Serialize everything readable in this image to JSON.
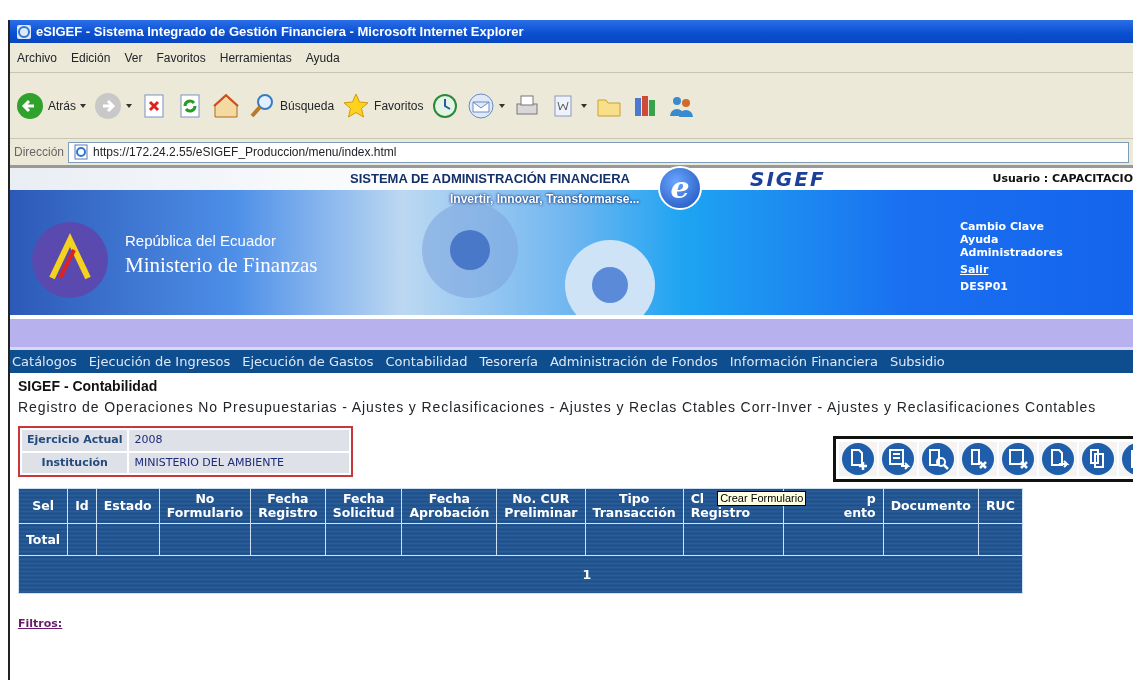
{
  "window": {
    "title": "eSIGEF - Sistema Integrado de Gestión Financiera - Microsoft Internet Explorer"
  },
  "menu": [
    "Archivo",
    "Edición",
    "Ver",
    "Favoritos",
    "Herramientas",
    "Ayuda"
  ],
  "browser_toolbar": [
    {
      "kind": "back",
      "label": "Atrás",
      "dropdown": true
    },
    {
      "kind": "forward",
      "dropdown": true
    },
    {
      "kind": "stop",
      "dropdown": false
    },
    {
      "kind": "refresh",
      "dropdown": false
    },
    {
      "kind": "home",
      "dropdown": false
    },
    {
      "kind": "search",
      "label": "Búsqueda",
      "dropdown": false
    },
    {
      "kind": "favorites",
      "label": "Favoritos",
      "dropdown": false
    },
    {
      "kind": "history",
      "dropdown": false
    },
    {
      "kind": "mail",
      "dropdown": true
    },
    {
      "kind": "print",
      "dropdown": false
    },
    {
      "kind": "word",
      "dropdown": true
    },
    {
      "kind": "folder",
      "dropdown": false
    },
    {
      "kind": "tool",
      "dropdown": false
    },
    {
      "kind": "people",
      "dropdown": false
    }
  ],
  "address_bar": {
    "label": "Dirección",
    "value": "https://172.24.2.55/eSIGEF_Produccion/menu/index.html"
  },
  "header": {
    "system_title": "SISTEMA DE ADMINISTRACIÓN FINANCIERA",
    "slogan": "Invertir, Innovar, Transformarse...",
    "e_logo": "e",
    "sigef_logo": "SIGEF",
    "country": "República del Ecuador",
    "ministry": "Ministerio de Finanzas",
    "user": "Usuario : CAPACITACIO",
    "links": [
      {
        "text": "Cambio Clave",
        "underlined": false
      },
      {
        "text": "Ayuda",
        "underlined": false
      },
      {
        "text": "Administradores",
        "underlined": false
      },
      {
        "text": "Salir",
        "underlined": true
      }
    ],
    "code": "DESP01"
  },
  "nav": [
    "Catálogos",
    "Ejecución de Ingresos",
    "Ejecución de Gastos",
    "Contabilidad",
    "Tesorería",
    "Administración de Fondos",
    "Información Financiera",
    "Subsidio"
  ],
  "page_title": "SIGEF - Contabilidad",
  "breadcrumb": "Registro de Operaciones No Presupuestarias - Ajustes y Reclasificaciones - Ajustes y Reclas Ctables Corr-Inver - Ajustes y Reclasificaciones Contables",
  "info": [
    {
      "label": "Ejercicio Actual",
      "value": "2008"
    },
    {
      "label": "Institución",
      "value": "MINISTERIO DEL AMBIENTE"
    }
  ],
  "actions": [
    {
      "kind": "new"
    },
    {
      "kind": "save-arrow"
    },
    {
      "kind": "view"
    },
    {
      "kind": "delete"
    },
    {
      "kind": "save-delete"
    },
    {
      "kind": "forward"
    },
    {
      "kind": "copy"
    },
    {
      "kind": "clipboard"
    }
  ],
  "tooltip": "Crear Formulario",
  "table": {
    "columns": [
      {
        "lines": [
          "Sel"
        ]
      },
      {
        "lines": [
          "Id"
        ]
      },
      {
        "lines": [
          "Estado"
        ]
      },
      {
        "lines": [
          "No",
          "Formulario"
        ]
      },
      {
        "lines": [
          "Fecha",
          "Registro"
        ]
      },
      {
        "lines": [
          "Fecha",
          "Solicitud"
        ]
      },
      {
        "lines": [
          "Fecha",
          "Aprobación"
        ]
      },
      {
        "lines": [
          "No. CUR",
          "Preliminar"
        ]
      },
      {
        "lines": [
          "Tipo",
          "Transacción"
        ]
      },
      {
        "lines": [
          "Cl",
          "Registro"
        ]
      },
      {
        "lines": [
          "p",
          "ento"
        ]
      },
      {
        "lines": [
          "Documento"
        ]
      },
      {
        "lines": [
          "RUC"
        ]
      }
    ],
    "total_label": "Total",
    "page": "1"
  },
  "filters_link": "Filtros:"
}
